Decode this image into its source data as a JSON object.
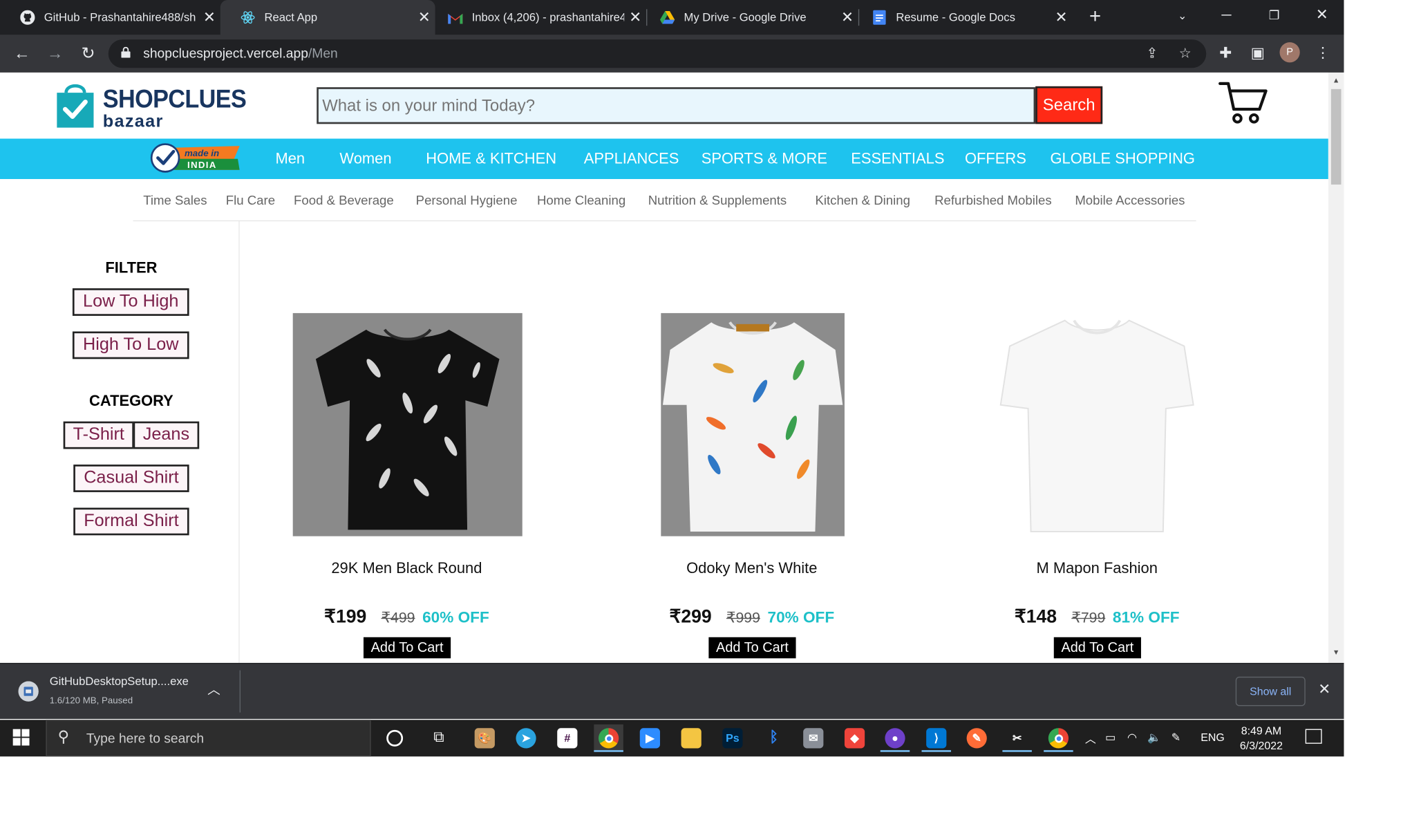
{
  "browser": {
    "tabs": [
      {
        "title": "GitHub - Prashantahire488/sh",
        "icon": "github-icon",
        "active": false
      },
      {
        "title": "React App",
        "icon": "react-icon",
        "active": true
      },
      {
        "title": "Inbox (4,206) - prashantahire4",
        "icon": "gmail-icon",
        "active": false
      },
      {
        "title": "My Drive - Google Drive",
        "icon": "google-drive-icon",
        "active": false
      },
      {
        "title": "Resume - Google Docs",
        "icon": "google-docs-icon",
        "active": false
      }
    ],
    "url_host": "shopcluesproject.vercel.app",
    "url_path": "/Men",
    "profile_initial": "P"
  },
  "header": {
    "logo_line1": "SHOPCLUES",
    "logo_line2": "bazaar",
    "search_placeholder": "What is on your mind Today?",
    "search_button": "Search",
    "made_in_line1": "made in",
    "made_in_line2": "INDIA"
  },
  "nav": {
    "items": [
      "Men",
      "Women",
      "HOME & KITCHEN",
      "APPLIANCES",
      "SPORTS & MORE",
      "ESSENTIALS",
      "OFFERS",
      "GLOBLE SHOPPING"
    ]
  },
  "subnav": {
    "items": [
      "Time Sales",
      "Flu Care",
      "Food & Beverage",
      "Personal Hygiene",
      "Home Cleaning",
      "Nutrition & Supplements",
      "Kitchen & Dining",
      "Refurbished Mobiles",
      "Mobile Accessories"
    ]
  },
  "sidebar": {
    "filter_heading": "FILTER",
    "sort_low_high": "Low To High",
    "sort_high_low": "High To Low",
    "category_heading": "CATEGORY",
    "cat_tshirt": "T-Shirt",
    "cat_jeans": "Jeans",
    "cat_casual": "Casual Shirt",
    "cat_formal": "Formal Shirt"
  },
  "products": [
    {
      "title": "29K Men Black Round",
      "price": "₹199",
      "mrp": "₹499",
      "discount": "60% OFF",
      "button": "Add To Cart"
    },
    {
      "title": "Odoky Men's White",
      "price": "₹299",
      "mrp": "₹999",
      "discount": "70% OFF",
      "button": "Add To Cart"
    },
    {
      "title": "M Mapon Fashion",
      "price": "₹148",
      "mrp": "₹799",
      "discount": "81% OFF",
      "button": "Add To Cart"
    }
  ],
  "download": {
    "filename": "GitHubDesktopSetup....exe",
    "status": "1.6/120 MB, Paused",
    "show_all": "Show all"
  },
  "taskbar": {
    "search_placeholder": "Type here to search",
    "language": "ENG",
    "time": "8:49 AM",
    "date": "6/3/2022"
  },
  "colors": {
    "nav_bar": "#1ec3ee",
    "search_button": "#ff2a16",
    "discount_text": "#1ec0c8",
    "filter_text": "#7a1f49"
  }
}
